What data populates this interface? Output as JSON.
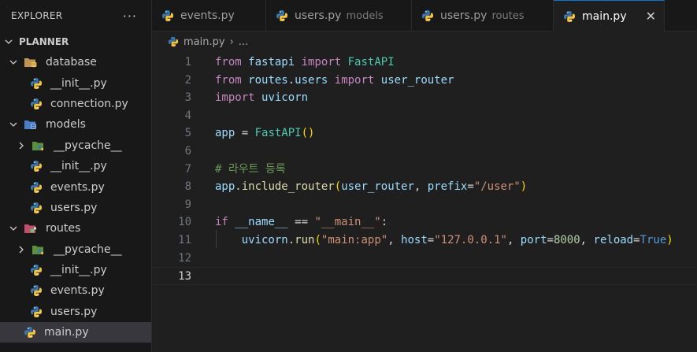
{
  "explorer": {
    "title": "EXPLORER",
    "more": "···",
    "root": "PLANNER",
    "items": [
      {
        "label": "database",
        "kind": "folder",
        "icon": "database-folder-icon",
        "expanded": true
      },
      {
        "label": "__init__.py",
        "kind": "py"
      },
      {
        "label": "connection.py",
        "kind": "py"
      },
      {
        "label": "models",
        "kind": "folder",
        "icon": "models-folder-icon",
        "expanded": true
      },
      {
        "label": "__pycache__",
        "kind": "folder",
        "icon": "pycache-folder-icon",
        "expanded": false
      },
      {
        "label": "__init__.py",
        "kind": "py"
      },
      {
        "label": "events.py",
        "kind": "py"
      },
      {
        "label": "users.py",
        "kind": "py"
      },
      {
        "label": "routes",
        "kind": "folder",
        "icon": "routes-folder-icon",
        "expanded": true
      },
      {
        "label": "__pycache__",
        "kind": "folder",
        "icon": "pycache-folder-icon",
        "expanded": false
      },
      {
        "label": "__init__.py",
        "kind": "py"
      },
      {
        "label": "events.py",
        "kind": "py"
      },
      {
        "label": "users.py",
        "kind": "py"
      },
      {
        "label": "main.py",
        "kind": "py",
        "active": true
      }
    ]
  },
  "tabs": [
    {
      "label": "events.py",
      "desc": ""
    },
    {
      "label": "users.py",
      "desc": "models"
    },
    {
      "label": "users.py",
      "desc": "routes"
    },
    {
      "label": "main.py",
      "desc": "",
      "active": true
    }
  ],
  "tab_close": "✕",
  "breadcrumb": {
    "file": "main.py",
    "sep": "›",
    "rest": "..."
  },
  "editor": {
    "current_line": 13,
    "lines": [
      {
        "n": "1",
        "tokens": [
          [
            "kw",
            "from"
          ],
          [
            "",
            "",
            " "
          ],
          [
            "var",
            "fastapi"
          ],
          [
            "",
            "",
            " "
          ],
          [
            "kw",
            "import"
          ],
          [
            "",
            "",
            " "
          ],
          [
            "cls",
            "FastAPI"
          ]
        ]
      },
      {
        "n": "2",
        "tokens": [
          [
            "kw",
            "from"
          ],
          [
            "",
            "",
            " "
          ],
          [
            "var",
            "routes"
          ],
          [
            "",
            "."
          ],
          [
            "var",
            "users"
          ],
          [
            "",
            "",
            " "
          ],
          [
            "kw",
            "import"
          ],
          [
            "",
            "",
            " "
          ],
          [
            "var",
            "user_router"
          ]
        ]
      },
      {
        "n": "3",
        "tokens": [
          [
            "kw",
            "import"
          ],
          [
            "",
            "",
            " "
          ],
          [
            "var",
            "uvicorn"
          ]
        ]
      },
      {
        "n": "4",
        "tokens": []
      },
      {
        "n": "5",
        "tokens": [
          [
            "var",
            "app"
          ],
          [
            "",
            "",
            " = "
          ],
          [
            "cls",
            "FastAPI"
          ],
          [
            "br",
            "()"
          ]
        ]
      },
      {
        "n": "6",
        "tokens": []
      },
      {
        "n": "7",
        "tokens": [
          [
            "cmt",
            "# 라우트 등록"
          ]
        ]
      },
      {
        "n": "8",
        "tokens": [
          [
            "var",
            "app"
          ],
          [
            "",
            "."
          ],
          [
            "fn",
            "include_router"
          ],
          [
            "br",
            "("
          ],
          [
            "var",
            "user_router"
          ],
          [
            "",
            ", "
          ],
          [
            "var",
            "prefix"
          ],
          [
            "",
            "="
          ],
          [
            "str",
            "\"/user\""
          ],
          [
            "br",
            ")"
          ]
        ]
      },
      {
        "n": "9",
        "tokens": []
      },
      {
        "n": "10",
        "tokens": [
          [
            "kw",
            "if"
          ],
          [
            "",
            "",
            " "
          ],
          [
            "var",
            "__name__"
          ],
          [
            "",
            "",
            " == "
          ],
          [
            "str",
            "\"__main__\""
          ],
          [
            "",
            ":"
          ]
        ]
      },
      {
        "n": "11",
        "tokens": [
          [
            "",
            "    "
          ],
          [
            "var",
            "uvicorn"
          ],
          [
            "",
            "."
          ],
          [
            "fn",
            "run"
          ],
          [
            "br",
            "("
          ],
          [
            "str",
            "\"main:app\""
          ],
          [
            "",
            ", "
          ],
          [
            "var",
            "host"
          ],
          [
            "",
            "="
          ],
          [
            "str",
            "\"127.0.0.1\""
          ],
          [
            "",
            ", "
          ],
          [
            "var",
            "port"
          ],
          [
            "",
            "="
          ],
          [
            "num",
            "8000"
          ],
          [
            "",
            ", "
          ],
          [
            "var",
            "reload"
          ],
          [
            "",
            "="
          ],
          [
            "bool",
            "True"
          ],
          [
            "br",
            ")"
          ]
        ]
      },
      {
        "n": "12",
        "tokens": []
      },
      {
        "n": "13",
        "tokens": []
      }
    ]
  },
  "colors": {
    "accent": "#0078d4",
    "sidebar_bg": "#181818",
    "editor_bg": "#1f1f1f"
  }
}
